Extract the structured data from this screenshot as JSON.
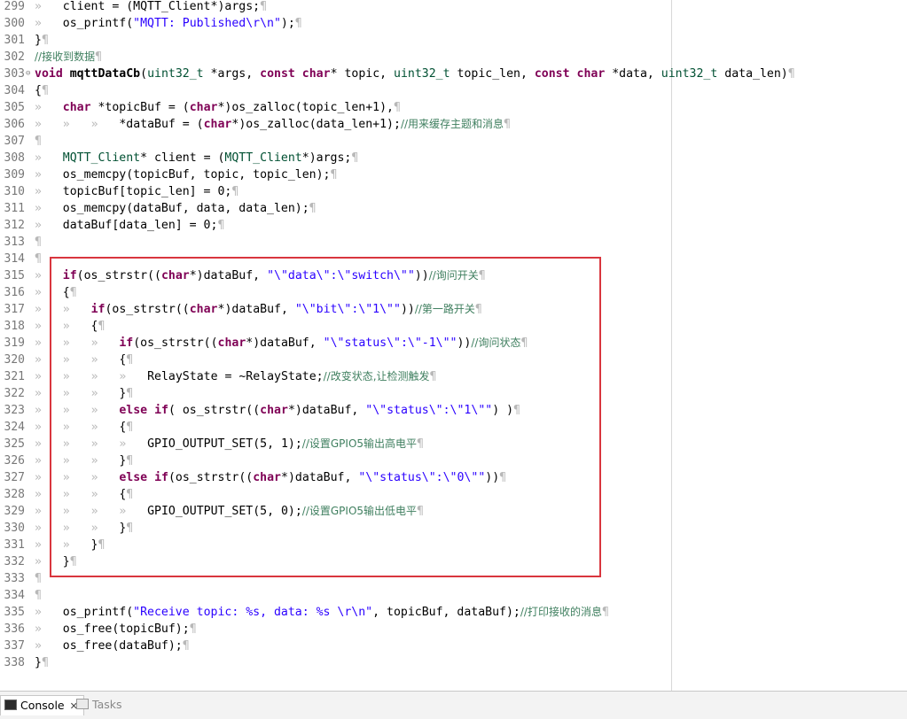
{
  "editor": {
    "lines": [
      {
        "n": "299",
        "segs": [
          [
            "ws",
            "» "
          ],
          [
            "",
            "  client = (MQTT_Client*)args;"
          ],
          [
            "ws",
            "¶"
          ]
        ]
      },
      {
        "n": "300",
        "segs": [
          [
            "ws",
            "» "
          ],
          [
            "",
            "  os_printf("
          ],
          [
            "str",
            "\"MQTT: Published\\r\\n\""
          ],
          [
            "",
            ");"
          ],
          [
            "ws",
            "¶"
          ]
        ]
      },
      {
        "n": "301",
        "segs": [
          [
            "",
            "}"
          ],
          [
            "ws",
            "¶"
          ]
        ]
      },
      {
        "n": "302",
        "segs": [
          [
            "cm",
            "//接收到数据"
          ],
          [
            "ws",
            "¶"
          ]
        ]
      },
      {
        "n": "303",
        "fold": true,
        "segs": [
          [
            "kw",
            "void"
          ],
          [
            "",
            " "
          ],
          [
            "fn",
            "mqttDataCb"
          ],
          [
            "",
            "("
          ],
          [
            "ty",
            "uint32_t"
          ],
          [
            "",
            " *args, "
          ],
          [
            "kw",
            "const"
          ],
          [
            "",
            " "
          ],
          [
            "kw",
            "char"
          ],
          [
            "",
            "* topic, "
          ],
          [
            "ty",
            "uint32_t"
          ],
          [
            "",
            " topic_len, "
          ],
          [
            "kw",
            "const"
          ],
          [
            "",
            " "
          ],
          [
            "kw",
            "char"
          ],
          [
            "",
            " *data, "
          ],
          [
            "ty",
            "uint32_t"
          ],
          [
            "",
            " data_len)"
          ],
          [
            "ws",
            "¶"
          ]
        ]
      },
      {
        "n": "304",
        "segs": [
          [
            "",
            "{"
          ],
          [
            "ws",
            "¶"
          ]
        ]
      },
      {
        "n": "305",
        "segs": [
          [
            "ws",
            "» "
          ],
          [
            "",
            "  "
          ],
          [
            "kw",
            "char"
          ],
          [
            "",
            " *topicBuf = ("
          ],
          [
            "kw",
            "char"
          ],
          [
            "",
            "*)os_zalloc(topic_len+1),"
          ],
          [
            "ws",
            "¶"
          ]
        ]
      },
      {
        "n": "306",
        "segs": [
          [
            "ws",
            "» "
          ],
          [
            "",
            "  "
          ],
          [
            "ws",
            "» "
          ],
          [
            "",
            "  "
          ],
          [
            "ws",
            "» "
          ],
          [
            "",
            "  *dataBuf = ("
          ],
          [
            "kw",
            "char"
          ],
          [
            "",
            "*)os_zalloc(data_len+1);"
          ],
          [
            "cm",
            "//用来缓存主题和消息"
          ],
          [
            "ws",
            "¶"
          ]
        ]
      },
      {
        "n": "307",
        "segs": [
          [
            "ws",
            "¶"
          ]
        ]
      },
      {
        "n": "308",
        "segs": [
          [
            "ws",
            "» "
          ],
          [
            "",
            "  "
          ],
          [
            "ty",
            "MQTT_Client"
          ],
          [
            "",
            "* client = ("
          ],
          [
            "ty",
            "MQTT_Client"
          ],
          [
            "",
            "*)args;"
          ],
          [
            "ws",
            "¶"
          ]
        ]
      },
      {
        "n": "309",
        "segs": [
          [
            "ws",
            "» "
          ],
          [
            "",
            "  os_memcpy(topicBuf, topic, topic_len);"
          ],
          [
            "ws",
            "¶"
          ]
        ]
      },
      {
        "n": "310",
        "segs": [
          [
            "ws",
            "» "
          ],
          [
            "",
            "  topicBuf[topic_len] = 0;"
          ],
          [
            "ws",
            "¶"
          ]
        ]
      },
      {
        "n": "311",
        "segs": [
          [
            "ws",
            "» "
          ],
          [
            "",
            "  os_memcpy(dataBuf, data, data_len);"
          ],
          [
            "ws",
            "¶"
          ]
        ]
      },
      {
        "n": "312",
        "segs": [
          [
            "ws",
            "» "
          ],
          [
            "",
            "  dataBuf[data_len] = 0;"
          ],
          [
            "ws",
            "¶"
          ]
        ]
      },
      {
        "n": "313",
        "segs": [
          [
            "ws",
            "¶"
          ]
        ]
      },
      {
        "n": "314",
        "segs": [
          [
            "ws",
            "¶"
          ]
        ]
      },
      {
        "n": "315",
        "segs": [
          [
            "ws",
            "» "
          ],
          [
            "",
            "  "
          ],
          [
            "kw",
            "if"
          ],
          [
            "",
            "(os_strstr(("
          ],
          [
            "kw",
            "char"
          ],
          [
            "",
            "*)dataBuf, "
          ],
          [
            "str",
            "\"\\\"data\\\":\\\"switch\\\"\""
          ],
          [
            "",
            "))"
          ],
          [
            "cm",
            "//询问开关"
          ],
          [
            "ws",
            "¶"
          ]
        ]
      },
      {
        "n": "316",
        "segs": [
          [
            "ws",
            "» "
          ],
          [
            "",
            "  {"
          ],
          [
            "ws",
            "¶"
          ]
        ]
      },
      {
        "n": "317",
        "segs": [
          [
            "ws",
            "» "
          ],
          [
            "",
            "  "
          ],
          [
            "ws",
            "» "
          ],
          [
            "",
            "  "
          ],
          [
            "kw",
            "if"
          ],
          [
            "",
            "(os_strstr(("
          ],
          [
            "kw",
            "char"
          ],
          [
            "",
            "*)dataBuf, "
          ],
          [
            "str",
            "\"\\\"bit\\\":\\\"1\\\"\""
          ],
          [
            "",
            "))"
          ],
          [
            "cm",
            "//第一路开关"
          ],
          [
            "ws",
            "¶"
          ]
        ]
      },
      {
        "n": "318",
        "segs": [
          [
            "ws",
            "» "
          ],
          [
            "",
            "  "
          ],
          [
            "ws",
            "» "
          ],
          [
            "",
            "  {"
          ],
          [
            "ws",
            "¶"
          ]
        ]
      },
      {
        "n": "319",
        "segs": [
          [
            "ws",
            "» "
          ],
          [
            "",
            "  "
          ],
          [
            "ws",
            "» "
          ],
          [
            "",
            "  "
          ],
          [
            "ws",
            "» "
          ],
          [
            "",
            "  "
          ],
          [
            "kw",
            "if"
          ],
          [
            "",
            "(os_strstr(("
          ],
          [
            "kw",
            "char"
          ],
          [
            "",
            "*)dataBuf, "
          ],
          [
            "str",
            "\"\\\"status\\\":\\\"-1\\\"\""
          ],
          [
            "",
            "))"
          ],
          [
            "cm",
            "//询问状态"
          ],
          [
            "ws",
            "¶"
          ]
        ]
      },
      {
        "n": "320",
        "segs": [
          [
            "ws",
            "» "
          ],
          [
            "",
            "  "
          ],
          [
            "ws",
            "» "
          ],
          [
            "",
            "  "
          ],
          [
            "ws",
            "» "
          ],
          [
            "",
            "  {"
          ],
          [
            "ws",
            "¶"
          ]
        ]
      },
      {
        "n": "321",
        "segs": [
          [
            "ws",
            "» "
          ],
          [
            "",
            "  "
          ],
          [
            "ws",
            "» "
          ],
          [
            "",
            "  "
          ],
          [
            "ws",
            "» "
          ],
          [
            "",
            "  "
          ],
          [
            "ws",
            "» "
          ],
          [
            "",
            "  RelayState = ~RelayState;"
          ],
          [
            "cm",
            "//改变状态,让检测触发"
          ],
          [
            "ws",
            "¶"
          ]
        ]
      },
      {
        "n": "322",
        "segs": [
          [
            "ws",
            "» "
          ],
          [
            "",
            "  "
          ],
          [
            "ws",
            "» "
          ],
          [
            "",
            "  "
          ],
          [
            "ws",
            "» "
          ],
          [
            "",
            "  }"
          ],
          [
            "ws",
            "¶"
          ]
        ]
      },
      {
        "n": "323",
        "segs": [
          [
            "ws",
            "» "
          ],
          [
            "",
            "  "
          ],
          [
            "ws",
            "» "
          ],
          [
            "",
            "  "
          ],
          [
            "ws",
            "» "
          ],
          [
            "",
            "  "
          ],
          [
            "kw",
            "else"
          ],
          [
            "",
            " "
          ],
          [
            "kw",
            "if"
          ],
          [
            "",
            "( os_strstr(("
          ],
          [
            "kw",
            "char"
          ],
          [
            "",
            "*)dataBuf, "
          ],
          [
            "str",
            "\"\\\"status\\\":\\\"1\\\"\""
          ],
          [
            "",
            ") )"
          ],
          [
            "ws",
            "¶"
          ]
        ]
      },
      {
        "n": "324",
        "segs": [
          [
            "ws",
            "» "
          ],
          [
            "",
            "  "
          ],
          [
            "ws",
            "» "
          ],
          [
            "",
            "  "
          ],
          [
            "ws",
            "» "
          ],
          [
            "",
            "  {"
          ],
          [
            "ws",
            "¶"
          ]
        ]
      },
      {
        "n": "325",
        "segs": [
          [
            "ws",
            "» "
          ],
          [
            "",
            "  "
          ],
          [
            "ws",
            "» "
          ],
          [
            "",
            "  "
          ],
          [
            "ws",
            "» "
          ],
          [
            "",
            "  "
          ],
          [
            "ws",
            "» "
          ],
          [
            "",
            "  GPIO_OUTPUT_SET(5, 1);"
          ],
          [
            "cm",
            "//设置GPIO5输出高电平"
          ],
          [
            "ws",
            "¶"
          ]
        ]
      },
      {
        "n": "326",
        "segs": [
          [
            "ws",
            "» "
          ],
          [
            "",
            "  "
          ],
          [
            "ws",
            "» "
          ],
          [
            "",
            "  "
          ],
          [
            "ws",
            "» "
          ],
          [
            "",
            "  }"
          ],
          [
            "ws",
            "¶"
          ]
        ]
      },
      {
        "n": "327",
        "segs": [
          [
            "ws",
            "» "
          ],
          [
            "",
            "  "
          ],
          [
            "ws",
            "» "
          ],
          [
            "",
            "  "
          ],
          [
            "ws",
            "» "
          ],
          [
            "",
            "  "
          ],
          [
            "kw",
            "else"
          ],
          [
            "",
            " "
          ],
          [
            "kw",
            "if"
          ],
          [
            "",
            "(os_strstr(("
          ],
          [
            "kw",
            "char"
          ],
          [
            "",
            "*)dataBuf, "
          ],
          [
            "str",
            "\"\\\"status\\\":\\\"0\\\"\""
          ],
          [
            "",
            "))"
          ],
          [
            "ws",
            "¶"
          ]
        ]
      },
      {
        "n": "328",
        "segs": [
          [
            "ws",
            "» "
          ],
          [
            "",
            "  "
          ],
          [
            "ws",
            "» "
          ],
          [
            "",
            "  "
          ],
          [
            "ws",
            "» "
          ],
          [
            "",
            "  {"
          ],
          [
            "ws",
            "¶"
          ]
        ]
      },
      {
        "n": "329",
        "segs": [
          [
            "ws",
            "» "
          ],
          [
            "",
            "  "
          ],
          [
            "ws",
            "» "
          ],
          [
            "",
            "  "
          ],
          [
            "ws",
            "» "
          ],
          [
            "",
            "  "
          ],
          [
            "ws",
            "» "
          ],
          [
            "",
            "  GPIO_OUTPUT_SET(5, 0);"
          ],
          [
            "cm",
            "//设置GPIO5输出低电平"
          ],
          [
            "ws",
            "¶"
          ]
        ]
      },
      {
        "n": "330",
        "segs": [
          [
            "ws",
            "» "
          ],
          [
            "",
            "  "
          ],
          [
            "ws",
            "» "
          ],
          [
            "",
            "  "
          ],
          [
            "ws",
            "» "
          ],
          [
            "",
            "  }"
          ],
          [
            "ws",
            "¶"
          ]
        ]
      },
      {
        "n": "331",
        "segs": [
          [
            "ws",
            "» "
          ],
          [
            "",
            "  "
          ],
          [
            "ws",
            "» "
          ],
          [
            "",
            "  }"
          ],
          [
            "ws",
            "¶"
          ]
        ]
      },
      {
        "n": "332",
        "segs": [
          [
            "ws",
            "» "
          ],
          [
            "",
            "  }"
          ],
          [
            "ws",
            "¶"
          ]
        ]
      },
      {
        "n": "333",
        "segs": [
          [
            "ws",
            "¶"
          ]
        ]
      },
      {
        "n": "334",
        "segs": [
          [
            "ws",
            "¶"
          ]
        ]
      },
      {
        "n": "335",
        "segs": [
          [
            "ws",
            "» "
          ],
          [
            "",
            "  os_printf("
          ],
          [
            "str",
            "\"Receive topic: %s, data: %s \\r\\n\""
          ],
          [
            "",
            ", topicBuf, dataBuf);"
          ],
          [
            "cm",
            "//打印接收的消息"
          ],
          [
            "ws",
            "¶"
          ]
        ]
      },
      {
        "n": "336",
        "segs": [
          [
            "ws",
            "» "
          ],
          [
            "",
            "  os_free(topicBuf);"
          ],
          [
            "ws",
            "¶"
          ]
        ]
      },
      {
        "n": "337",
        "segs": [
          [
            "ws",
            "» "
          ],
          [
            "",
            "  os_free(dataBuf);"
          ],
          [
            "ws",
            "¶"
          ]
        ]
      },
      {
        "n": "338",
        "segs": [
          [
            "",
            "}"
          ],
          [
            "ws",
            "¶"
          ]
        ]
      }
    ]
  },
  "colors": {
    "highlight_border": "#d9363e",
    "keyword": "#7f0055",
    "string": "#2a00ff",
    "comment": "#3f7f5f"
  },
  "bottom_tabs": {
    "console_label": "Console",
    "tasks_label": "Tasks",
    "console_icon": "console-icon",
    "tasks_icon": "tasks-icon",
    "close_icon": "close-icon"
  }
}
